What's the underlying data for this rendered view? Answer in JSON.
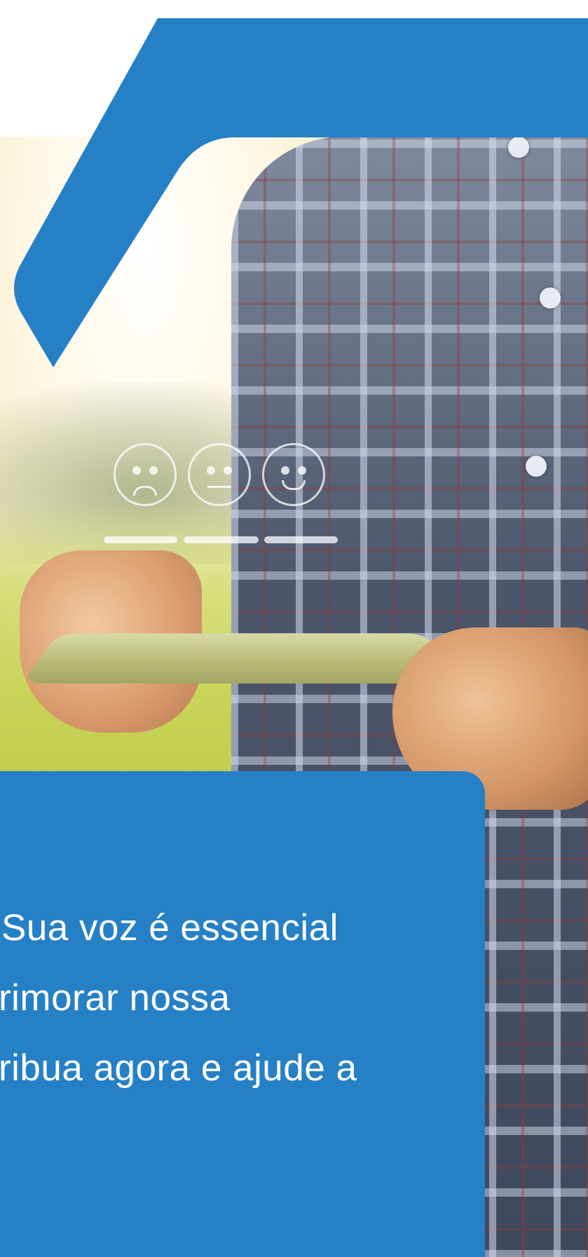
{
  "colors": {
    "brand_blue": "#2680c6",
    "background": "#ffffff"
  },
  "hero": {
    "rating_icons": [
      "sad-face-icon",
      "neutral-face-icon",
      "happy-face-icon"
    ]
  },
  "message": {
    "lines": [
      "Sua voz é essencial",
      "rimorar nossa",
      "ribua agora e ajude a"
    ]
  }
}
